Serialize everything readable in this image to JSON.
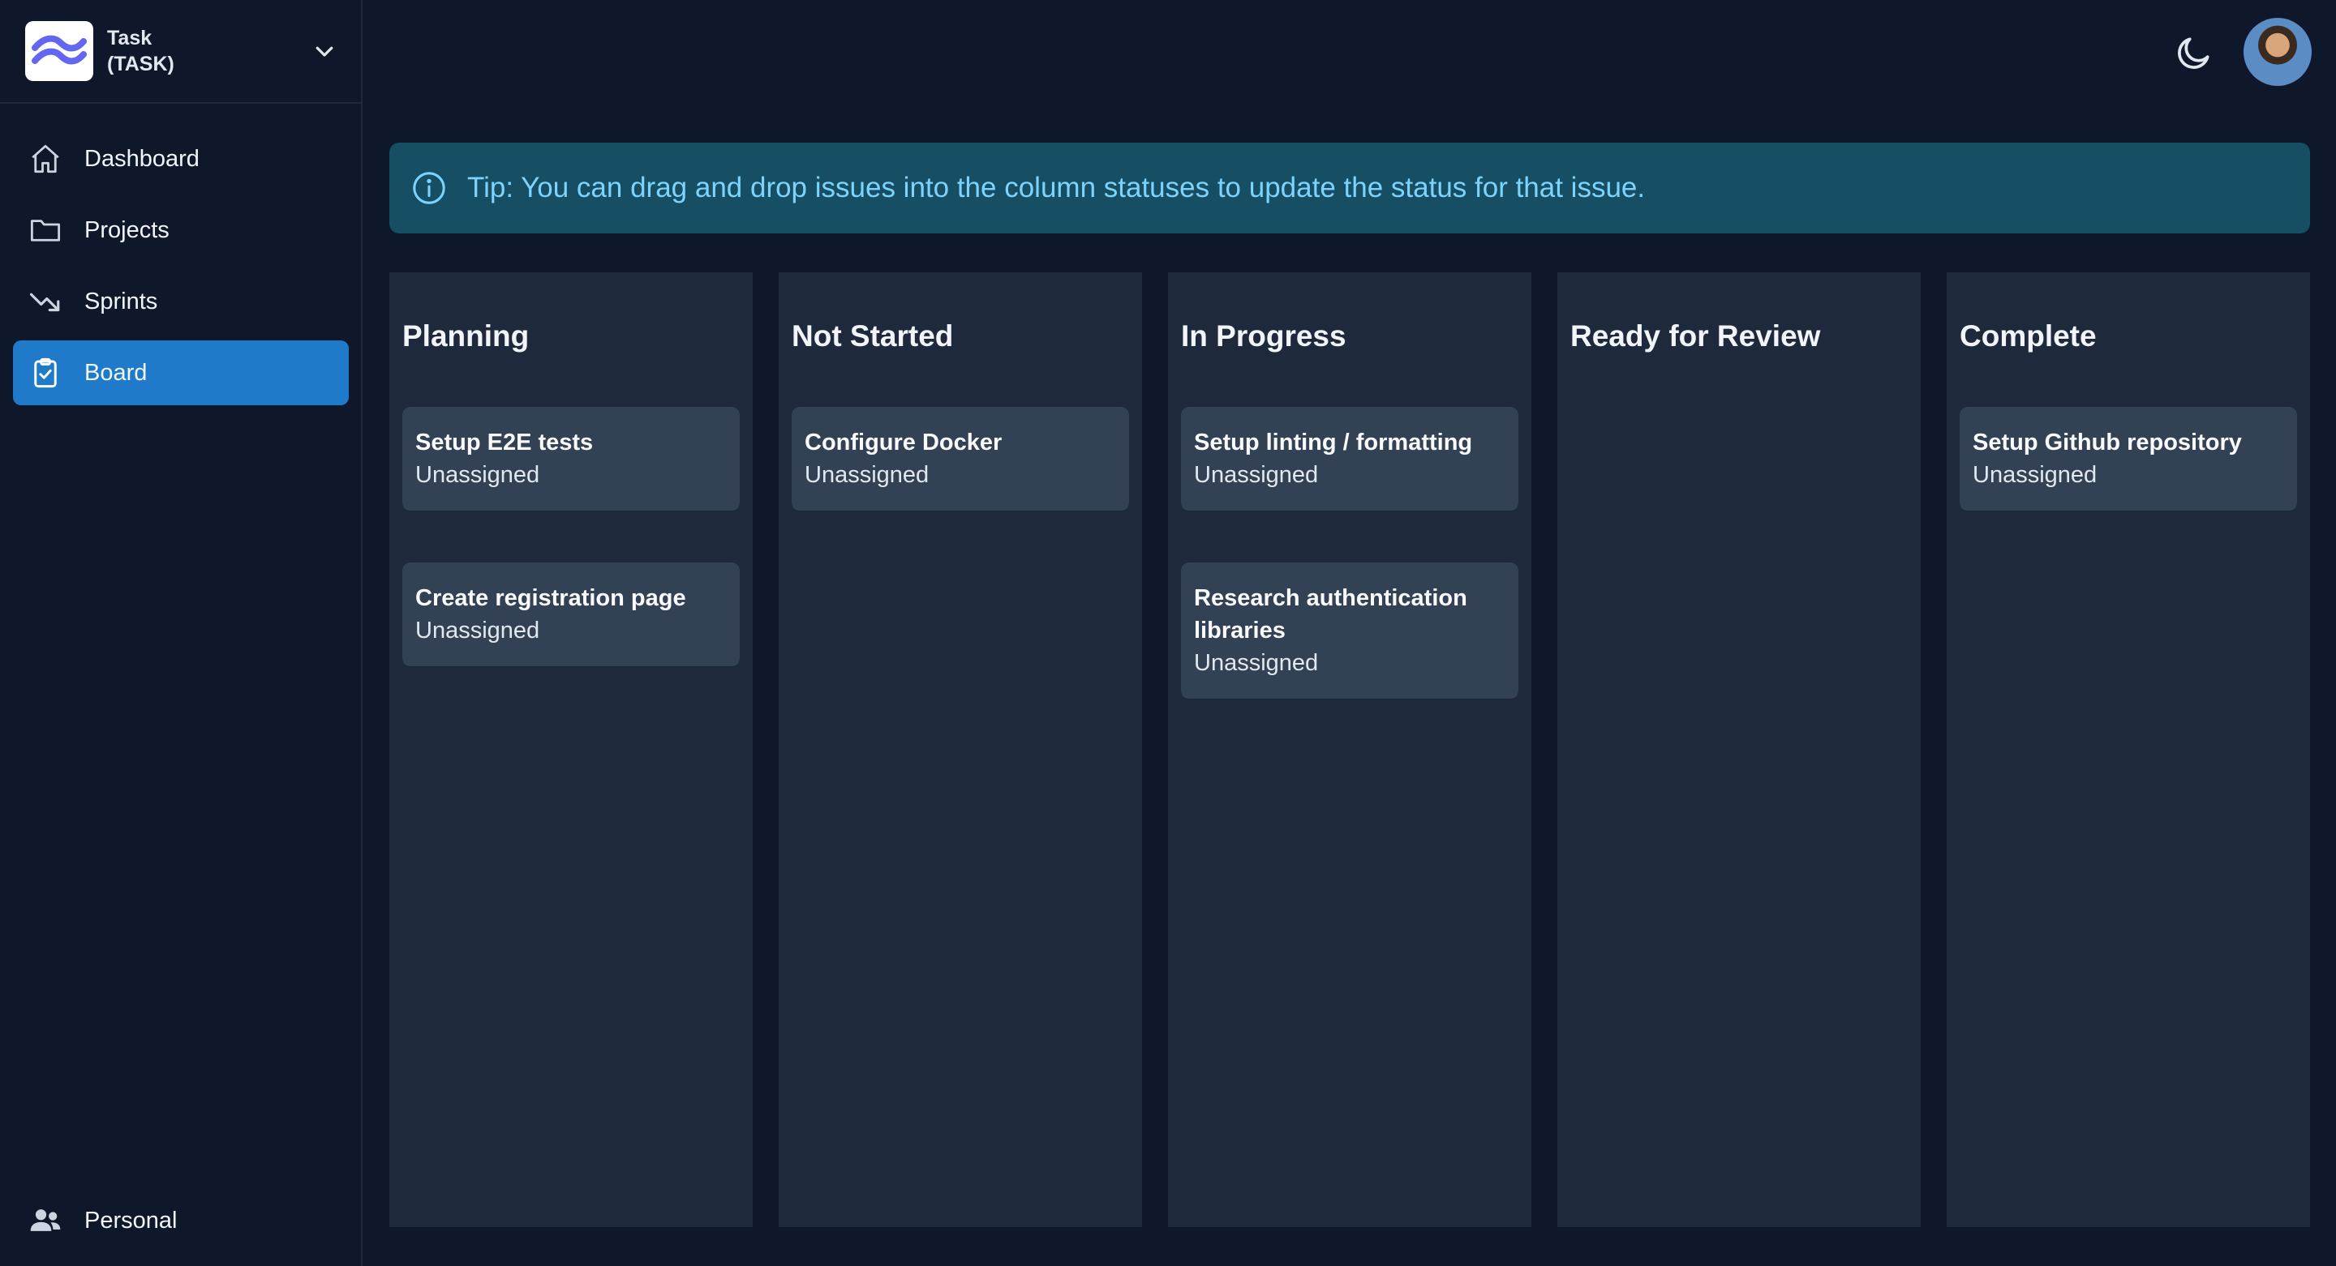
{
  "project": {
    "name": "Task",
    "key": "(TASK)"
  },
  "nav": {
    "items": [
      {
        "label": "Dashboard",
        "icon": "home-icon"
      },
      {
        "label": "Projects",
        "icon": "folder-icon"
      },
      {
        "label": "Sprints",
        "icon": "trending-down-icon"
      },
      {
        "label": "Board",
        "icon": "clipboard-check-icon",
        "active": true
      }
    ],
    "bottom": {
      "label": "Personal",
      "icon": "users-icon"
    }
  },
  "tip": "Tip: You can drag and drop issues into the column statuses to update the status for that issue.",
  "columns": [
    {
      "title": "Planning",
      "cards": [
        {
          "title": "Setup E2E tests",
          "assignee": "Unassigned"
        },
        {
          "title": "Create registration page",
          "assignee": "Unassigned"
        }
      ]
    },
    {
      "title": "Not Started",
      "cards": [
        {
          "title": "Configure Docker",
          "assignee": "Unassigned"
        }
      ]
    },
    {
      "title": "In Progress",
      "cards": [
        {
          "title": "Setup linting / formatting",
          "assignee": "Unassigned"
        },
        {
          "title": "Research authentication libraries",
          "assignee": "Unassigned"
        }
      ]
    },
    {
      "title": "Ready for Review",
      "cards": []
    },
    {
      "title": "Complete",
      "cards": [
        {
          "title": "Setup Github repository",
          "assignee": "Unassigned"
        }
      ]
    }
  ],
  "colors": {
    "background": "#0f172a",
    "column": "#1e293b",
    "card": "#334155",
    "active_nav": "#1f7bc9",
    "tip_bg": "#164e63",
    "tip_text": "#7dd3fc"
  }
}
